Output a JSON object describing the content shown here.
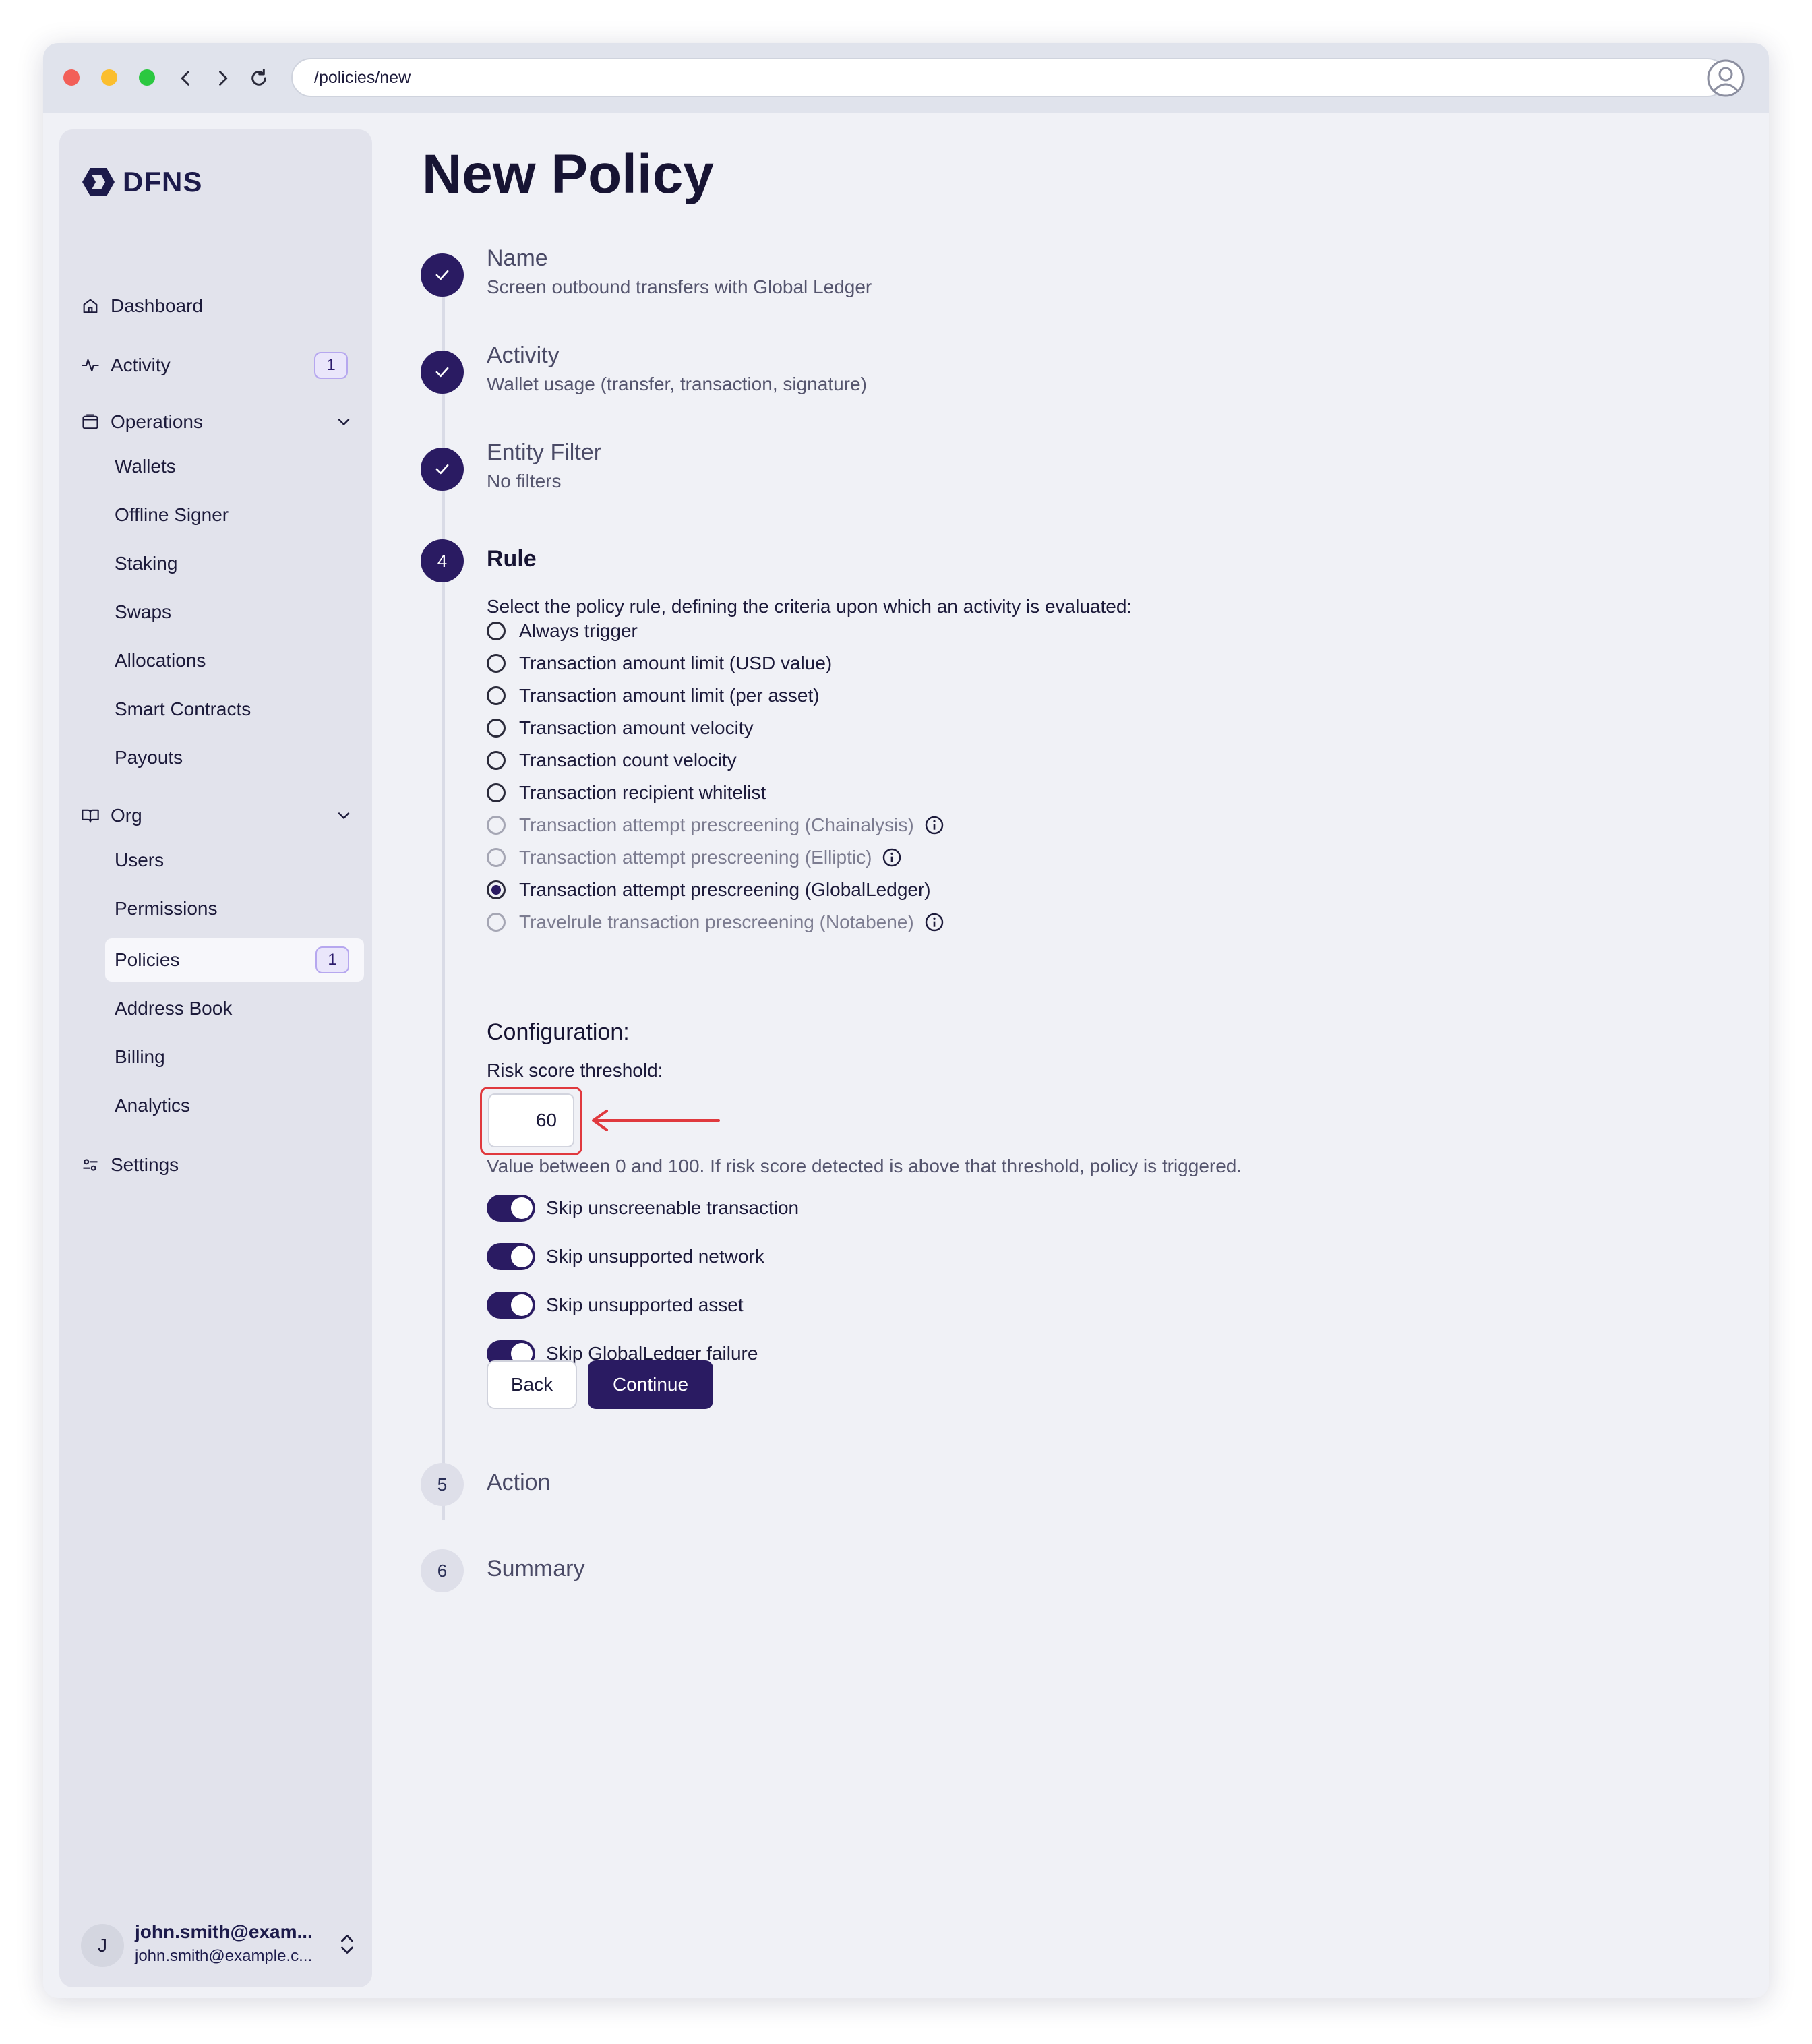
{
  "browser": {
    "url": "/policies/new",
    "traffic_colors": {
      "close": "#f25f58",
      "minimize": "#fbbe2e",
      "maximize": "#2bc840"
    }
  },
  "sidebar": {
    "logo": "DFNS",
    "nav": {
      "dashboard": "Dashboard",
      "activity": "Activity",
      "activity_badge": "1",
      "operations": "Operations",
      "operations_items": [
        "Wallets",
        "Offline Signer",
        "Staking",
        "Swaps",
        "Allocations",
        "Smart Contracts",
        "Payouts"
      ],
      "org": "Org",
      "org_items": [
        "Users",
        "Permissions",
        "Policies",
        "Address Book",
        "Billing",
        "Analytics"
      ],
      "policies_badge": "1",
      "settings": "Settings"
    },
    "user": {
      "initial": "J",
      "name": "john.smith@exam...",
      "email": "john.smith@example.c..."
    }
  },
  "page": {
    "title": "New Policy",
    "accent_color": "#2a1b62",
    "steps": [
      {
        "number": "1",
        "title": "Name",
        "subtitle": "Screen outbound transfers with Global Ledger",
        "state": "done"
      },
      {
        "number": "2",
        "title": "Activity",
        "subtitle": "Wallet usage (transfer, transaction, signature)",
        "state": "done"
      },
      {
        "number": "3",
        "title": "Entity Filter",
        "subtitle": "No filters",
        "state": "done"
      },
      {
        "number": "4",
        "title": "Rule",
        "state": "current"
      },
      {
        "number": "5",
        "title": "Action",
        "state": "pending"
      },
      {
        "number": "6",
        "title": "Summary",
        "state": "pending"
      }
    ],
    "rule": {
      "prompt": "Select the policy rule, defining the criteria upon which an activity is evaluated:",
      "options": [
        {
          "label": "Always trigger",
          "disabled": false,
          "checked": false
        },
        {
          "label": "Transaction amount limit (USD value)",
          "disabled": false,
          "checked": false
        },
        {
          "label": "Transaction amount limit (per asset)",
          "disabled": false,
          "checked": false
        },
        {
          "label": "Transaction amount velocity",
          "disabled": false,
          "checked": false
        },
        {
          "label": "Transaction count velocity",
          "disabled": false,
          "checked": false
        },
        {
          "label": "Transaction recipient whitelist",
          "disabled": false,
          "checked": false
        },
        {
          "label": "Transaction attempt prescreening (Chainalysis)",
          "disabled": true,
          "checked": false,
          "info": true
        },
        {
          "label": "Transaction attempt prescreening (Elliptic)",
          "disabled": true,
          "checked": false,
          "info": true
        },
        {
          "label": "Transaction attempt prescreening (GlobalLedger)",
          "disabled": false,
          "checked": true
        },
        {
          "label": "Travelrule transaction prescreening (Notabene)",
          "disabled": true,
          "checked": false,
          "info": true
        }
      ],
      "configuration_title": "Configuration:",
      "risk_label": "Risk score threshold:",
      "risk_value": "60",
      "risk_hint": "Value between 0 and 100. If risk score detected is above that threshold, policy is triggered.",
      "toggles": [
        {
          "label": "Skip unscreenable transaction",
          "on": true
        },
        {
          "label": "Skip unsupported network",
          "on": true
        },
        {
          "label": "Skip unsupported asset",
          "on": true
        },
        {
          "label": "Skip GlobalLedger failure",
          "on": true
        }
      ],
      "back_label": "Back",
      "continue_label": "Continue"
    }
  }
}
